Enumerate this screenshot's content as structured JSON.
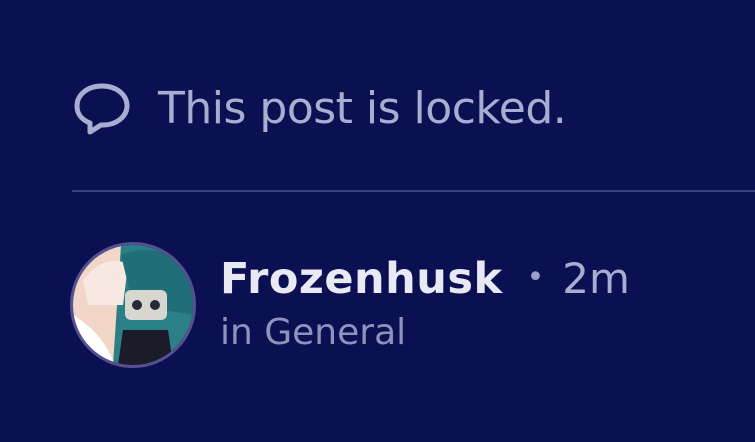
{
  "notice": {
    "icon": "comment-icon",
    "text": "This post is locked."
  },
  "post": {
    "avatar_icon": "user-avatar",
    "username": "Frozenhusk",
    "separator": "•",
    "time": "2m",
    "channel": "in General"
  },
  "colors": {
    "background": "#0b1052",
    "divider": "#3a417a",
    "muted_text": "#a9aed0",
    "username_text": "#e8e9f3"
  }
}
